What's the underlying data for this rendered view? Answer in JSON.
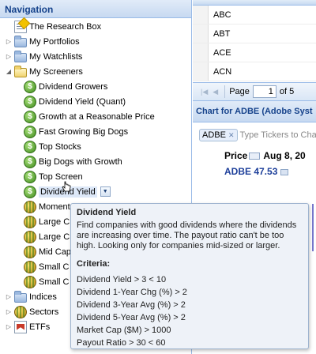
{
  "nav": {
    "title": "Navigation",
    "items": [
      {
        "label": "The Research Box",
        "icon": "research-box-icon"
      },
      {
        "label": "My Portfolios",
        "icon": "folder-icon"
      },
      {
        "label": "My Watchlists",
        "icon": "folder-icon"
      },
      {
        "label": "My Screeners",
        "icon": "folder-open-icon"
      },
      {
        "label": "Dividend Growers",
        "icon": "screener-icon"
      },
      {
        "label": "Dividend Yield (Quant)",
        "icon": "screener-icon"
      },
      {
        "label": "Growth at a Reasonable Price",
        "icon": "screener-icon"
      },
      {
        "label": "Fast Growing Big Dogs",
        "icon": "screener-icon"
      },
      {
        "label": "Top Stocks",
        "icon": "screener-icon"
      },
      {
        "label": "Big Dogs with Growth",
        "icon": "screener-icon"
      },
      {
        "label": "Top Screen",
        "icon": "screener-icon"
      },
      {
        "label": "Dividend Yield",
        "icon": "screener-icon"
      },
      {
        "label": "Momentum",
        "icon": "globe-screener-icon"
      },
      {
        "label": "Large C",
        "icon": "globe-screener-icon"
      },
      {
        "label": "Large C",
        "icon": "globe-screener-icon"
      },
      {
        "label": "Mid Cap",
        "icon": "globe-screener-icon"
      },
      {
        "label": "Small C",
        "icon": "globe-screener-icon"
      },
      {
        "label": "Small C",
        "icon": "globe-screener-icon"
      },
      {
        "label": "Indices",
        "icon": "folder-icon"
      },
      {
        "label": "Sectors",
        "icon": "globe-icon"
      },
      {
        "label": "ETFs",
        "icon": "etf-icon"
      }
    ]
  },
  "grid": {
    "rows": [
      "ABC",
      "ABT",
      "ACE",
      "ACN"
    ]
  },
  "pager": {
    "page_label": "Page",
    "page_value": "1",
    "of_label": "of 5"
  },
  "chart_panel": {
    "title": "Chart for ADBE (Adobe Syst",
    "ticker": "ADBE",
    "ticker_placeholder": "Type Tickers to Cha",
    "price_label": "Price",
    "price_date": "Aug 8, 20",
    "quote": "ADBE 47.53"
  },
  "tooltip": {
    "title": "Dividend Yield",
    "description": "Find companies with good dividends where the dividends are increasing over time. The payout ratio can't be too high. Looking only for companies mid-sized or larger.",
    "criteria_title": "Criteria:",
    "criteria": [
      "Dividend Yield > 3 < 10",
      "Dividend 1-Year Chg (%) > 2",
      "Dividend 3-Year Avg (%) > 2",
      "Dividend 5-Year Avg (%) > 2",
      "Market Cap ($M) > 1000",
      "Payout Ratio > 30 < 60"
    ]
  },
  "colors": {
    "header_text": "#15428b",
    "quote_text": "#1d3f9a",
    "panel_border": "#99bbe8"
  }
}
